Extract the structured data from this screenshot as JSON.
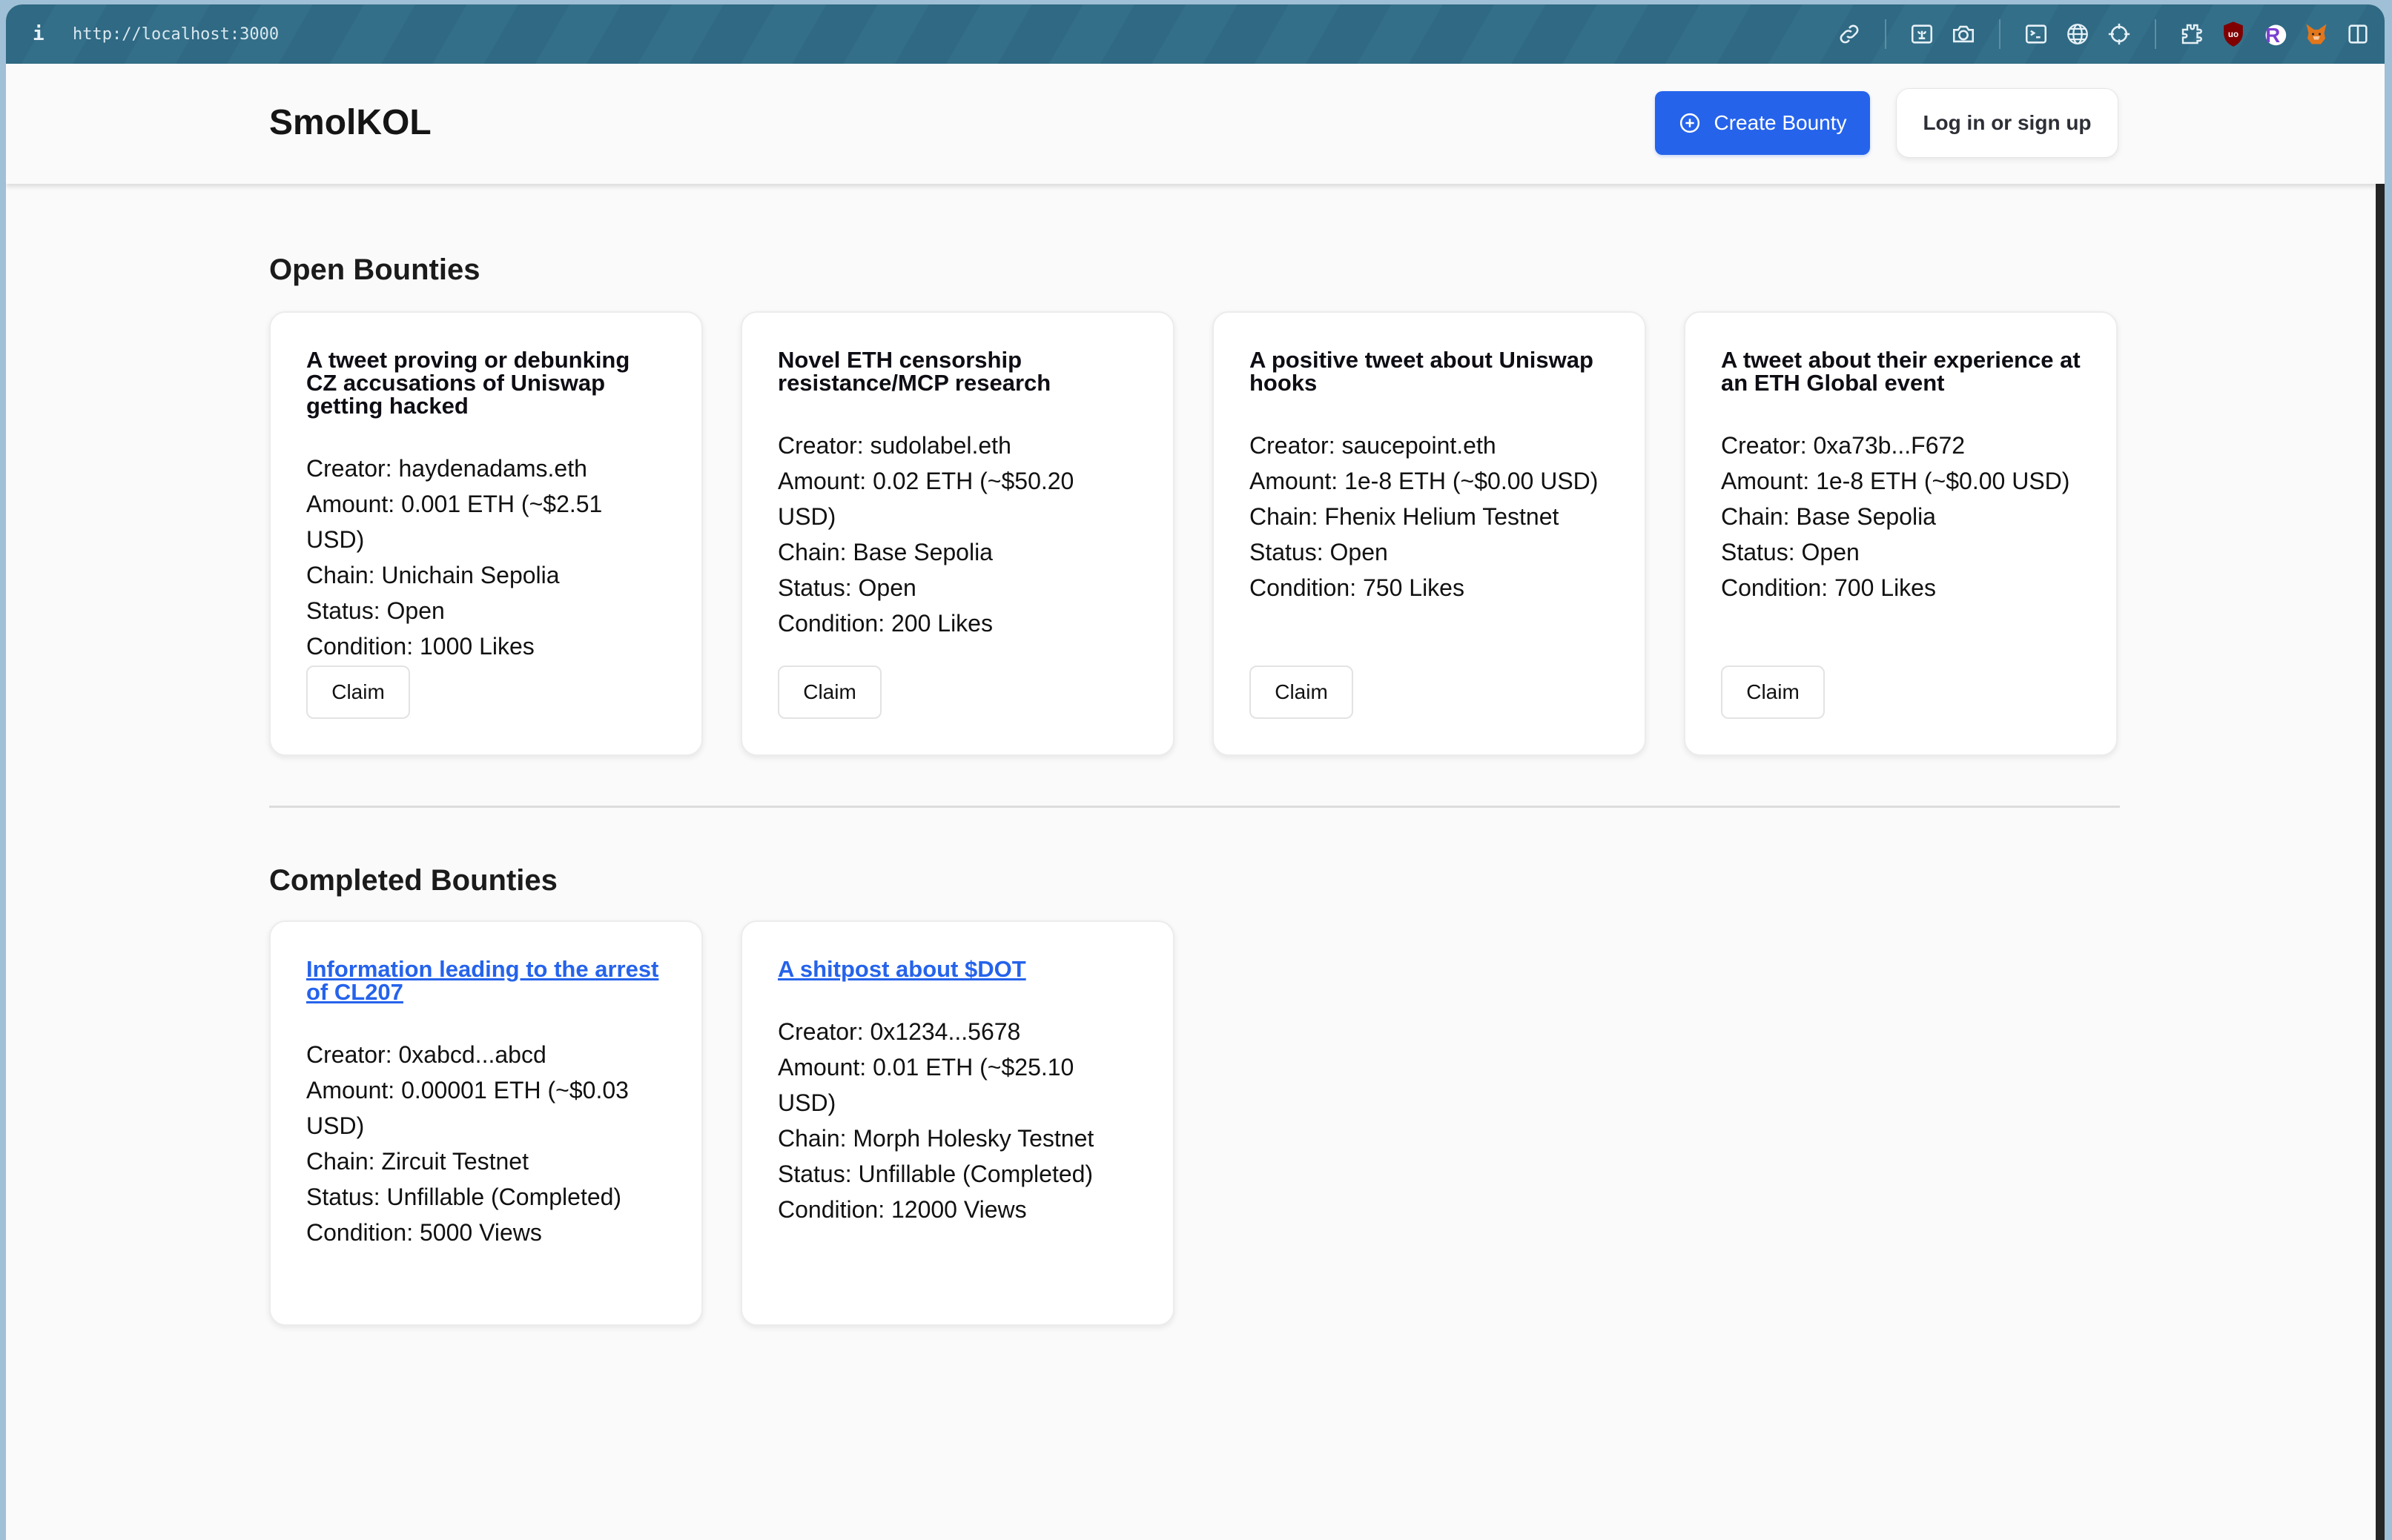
{
  "browser": {
    "url": "http://localhost:3000",
    "info_icon": "i",
    "toolbar_icons": [
      "link-icon",
      "image-capture-icon",
      "camera-icon",
      "terminal-icon",
      "globe-icon",
      "crosshair-icon",
      "extensions-puzzle-icon",
      "ublock-origin-icon",
      "r-extension-icon",
      "metamask-fox-icon",
      "sidebar-toggle-icon"
    ]
  },
  "header": {
    "brand": "SmolKOL",
    "create_bounty_label": "Create Bounty",
    "login_label": "Log in or sign up"
  },
  "open_bounties": {
    "title": "Open Bounties",
    "claim_label": "Claim",
    "cards": [
      {
        "title": "A tweet proving or debunking CZ accusations of Uniswap getting hacked",
        "creator": "Creator: haydenadams.eth",
        "amount": "Amount: 0.001 ETH (~$2.51 USD)",
        "chain": "Chain: Unichain Sepolia",
        "status": "Status: Open",
        "condition": "Condition: 1000 Likes"
      },
      {
        "title": "Novel ETH censorship resistance/MCP research",
        "creator": "Creator: sudolabel.eth",
        "amount": "Amount: 0.02 ETH (~$50.20 USD)",
        "chain": "Chain: Base Sepolia",
        "status": "Status: Open",
        "condition": "Condition: 200 Likes"
      },
      {
        "title": "A positive tweet about Uniswap hooks",
        "creator": "Creator: saucepoint.eth",
        "amount": "Amount: 1e-8 ETH (~$0.00 USD)",
        "chain": "Chain: Fhenix Helium Testnet",
        "status": "Status: Open",
        "condition": "Condition: 750 Likes"
      },
      {
        "title": "A tweet about their experience at an ETH Global event",
        "creator": "Creator: 0xa73b...F672",
        "amount": "Amount: 1e-8 ETH (~$0.00 USD)",
        "chain": "Chain: Base Sepolia",
        "status": "Status: Open",
        "condition": "Condition: 700 Likes"
      }
    ]
  },
  "completed_bounties": {
    "title": "Completed Bounties",
    "cards": [
      {
        "title": "Information leading to the arrest of CL207",
        "creator": "Creator: 0xabcd...abcd",
        "amount": "Amount: 0.00001 ETH (~$0.03 USD)",
        "chain": "Chain: Zircuit Testnet",
        "status": "Status: Unfillable (Completed)",
        "condition": "Condition: 5000 Views"
      },
      {
        "title": "A shitpost about $DOT",
        "creator": "Creator: 0x1234...5678",
        "amount": "Amount: 0.01 ETH (~$25.10 USD)",
        "chain": "Chain: Morph Holesky Testnet",
        "status": "Status: Unfillable (Completed)",
        "condition": "Condition: 12000 Views"
      }
    ]
  },
  "colors": {
    "primary": "#2563eb",
    "link": "#2563eb",
    "page_bg": "#fafafa",
    "toolbar_bg": "#2f6983"
  }
}
